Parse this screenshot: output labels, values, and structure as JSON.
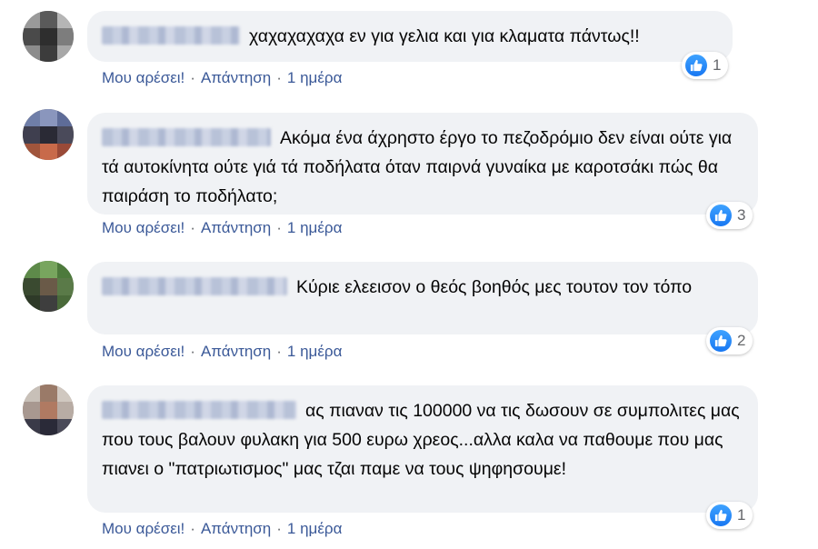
{
  "comments": [
    {
      "text": "χαχαχαχαχα εν για γελια και για κλαματα πάντως!!",
      "like_label": "Μου αρέσει!",
      "reply_label": "Απάντηση",
      "time": "1 ημέρα",
      "reaction_count": "1"
    },
    {
      "text": "Ακόμα ένα άχρηστο έργο το πεζοδρόμιο δεν είναι ούτε για τά αυτοκίνητα ούτε γιά τά ποδήλατα όταν παιρνά γυναίκα με καροτσάκι πώς θα παιράση το ποδήλατο;",
      "like_label": "Μου αρέσει!",
      "reply_label": "Απάντηση",
      "time": "1 ημέρα",
      "reaction_count": "3"
    },
    {
      "text": "Κύριε ελεεισον ο θεός βοηθός μες τουτον τον τόπο",
      "like_label": "Μου αρέσει!",
      "reply_label": "Απάντηση",
      "time": "1 ημέρα",
      "reaction_count": "2"
    },
    {
      "text": "ας πιαναν τις 100000 να τις δωσουν σε συμπολιτες μας που τους βαλουν φυλακη για 500 ευρω χρεος...αλλα καλα να παθουμε που μας πιανει ο \"πατριωτισμος\" μας τζαι παμε να τους ψηφησουμε!",
      "like_label": "Μου αρέσει!",
      "reply_label": "Απάντηση",
      "time": "1 ημέρα",
      "reaction_count": "1"
    }
  ],
  "separator": "·",
  "colors": {
    "bubble": "#f0f2f5",
    "link": "#3b5998",
    "like": "#1877f2"
  },
  "icons": {
    "reaction": "like-thumb-icon"
  }
}
